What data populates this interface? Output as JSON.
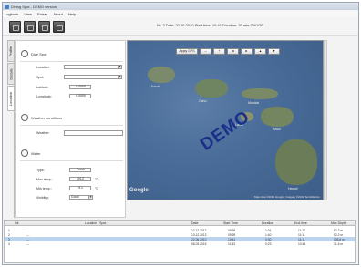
{
  "window": {
    "title": "Diving Spot - DEMO version"
  },
  "menu": {
    "items": [
      "Logbook",
      "View",
      "Extras",
      "About",
      "Help"
    ]
  },
  "status": {
    "text": "Nr: 3   Date: 22.06.2010   Start time: 10:41   Duration: 30 min   GAUGE"
  },
  "tabs": [
    "Profile",
    "Details",
    "Location"
  ],
  "dive_spot": {
    "title": "Dive Spot",
    "location_label": "Location:",
    "spot_label": "Spot:",
    "latitude_label": "Latitude:",
    "latitude_value": "0.0000",
    "longitude_label": "Longitude:",
    "longitude_value": "0.0000"
  },
  "weather": {
    "title": "Weather conditions",
    "label": "Weather:"
  },
  "water": {
    "title": "Water",
    "type_label": "Type:",
    "type_value": "Fresh",
    "max_temp_label": "Max temp.:",
    "max_temp_value": "24.2",
    "min_temp_label": "Min temp.:",
    "min_temp_value": "9.1",
    "unit": "°C",
    "visibility_label": "Visibility:",
    "visibility_value": "Good"
  },
  "map": {
    "apply_btn": "Apply GPS",
    "nav_btns": [
      "–",
      "+",
      "◄",
      "►",
      "▲",
      "▼"
    ],
    "watermark": "DEMO",
    "google": "Google",
    "footer": "Map data ©2011 Google, Imagery ©2011 TerraMetrics",
    "labels": [
      "Kauai",
      "Oahu",
      "Molokai",
      "Maui",
      "Lanai",
      "Hawaii"
    ]
  },
  "table": {
    "headers": [
      "Nr",
      "Location / Spot",
      "Date",
      "Start Time",
      "Duration",
      "End time",
      "Max Depth"
    ],
    "rows": [
      [
        "1",
        "---",
        "12.12.2013",
        "09:35",
        "1:01",
        "11:12",
        "52.3 m"
      ],
      [
        "2",
        "---",
        "13.12.2013",
        "09:25",
        "1:40",
        "11:11",
        "52.2 m"
      ],
      [
        "3",
        "---",
        "22.06.2010",
        "10:41",
        "0:30",
        "11:11",
        "105.8 m"
      ],
      [
        "4",
        "---",
        "06.03.2015",
        "11:33",
        "0:23",
        "10:45",
        "31.6 m"
      ]
    ]
  },
  "colors": {
    "selected_row": "#bcd3ee",
    "demo": "#1b2f8a",
    "map_water": "#4a6d99"
  }
}
